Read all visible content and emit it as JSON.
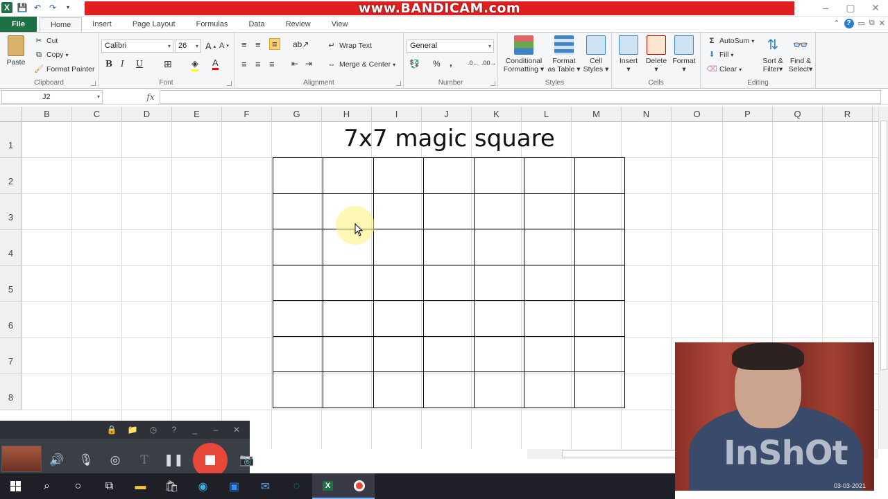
{
  "titlebar": {
    "overlay_banner": "www.BANDICAM.com",
    "window_controls": [
      "–",
      "▢",
      "✕"
    ]
  },
  "tabs": [
    "File",
    "Home",
    "Insert",
    "Page Layout",
    "Formulas",
    "Data",
    "Review",
    "View"
  ],
  "ribbon": {
    "clipboard": {
      "paste": "Paste",
      "cut": "Cut",
      "copy": "Copy",
      "format_painter": "Format Painter",
      "label": "Clipboard"
    },
    "font": {
      "name": "Calibri",
      "size": "26",
      "label": "Font",
      "bold": "B",
      "italic": "I",
      "underline": "U"
    },
    "alignment": {
      "wrap": "Wrap Text",
      "merge": "Merge & Center",
      "label": "Alignment"
    },
    "number": {
      "format": "General",
      "percent": "%",
      "comma": ",",
      "label": "Number"
    },
    "styles": {
      "conditional": "Conditional",
      "conditional2": "Formatting",
      "format_table": "Format",
      "format_table2": "as Table",
      "cell_styles": "Cell",
      "cell_styles2": "Styles",
      "label": "Styles"
    },
    "cells": {
      "insert": "Insert",
      "delete": "Delete",
      "format": "Format",
      "label": "Cells"
    },
    "editing": {
      "autosum": "AutoSum",
      "fill": "Fill",
      "clear": "Clear",
      "sort": "Sort &",
      "sort2": "Filter",
      "find": "Find &",
      "find2": "Select",
      "label": "Editing"
    }
  },
  "formula_bar": {
    "name_box": "J2",
    "fx": "fx",
    "value": ""
  },
  "columns": [
    "B",
    "C",
    "D",
    "E",
    "F",
    "G",
    "H",
    "I",
    "J",
    "K",
    "L",
    "M",
    "N",
    "O",
    "P",
    "Q",
    "R"
  ],
  "rows": [
    "1",
    "2",
    "3",
    "4",
    "5",
    "6",
    "7",
    "8"
  ],
  "sheet": {
    "title": "7x7 magic square",
    "grid_size": 7
  },
  "webcam": {
    "watermark": "InShOt",
    "date": "03-03-2021"
  },
  "colors": {
    "excel_green": "#1e7145",
    "banner_red": "#e02020",
    "record_red": "#e8483a"
  }
}
